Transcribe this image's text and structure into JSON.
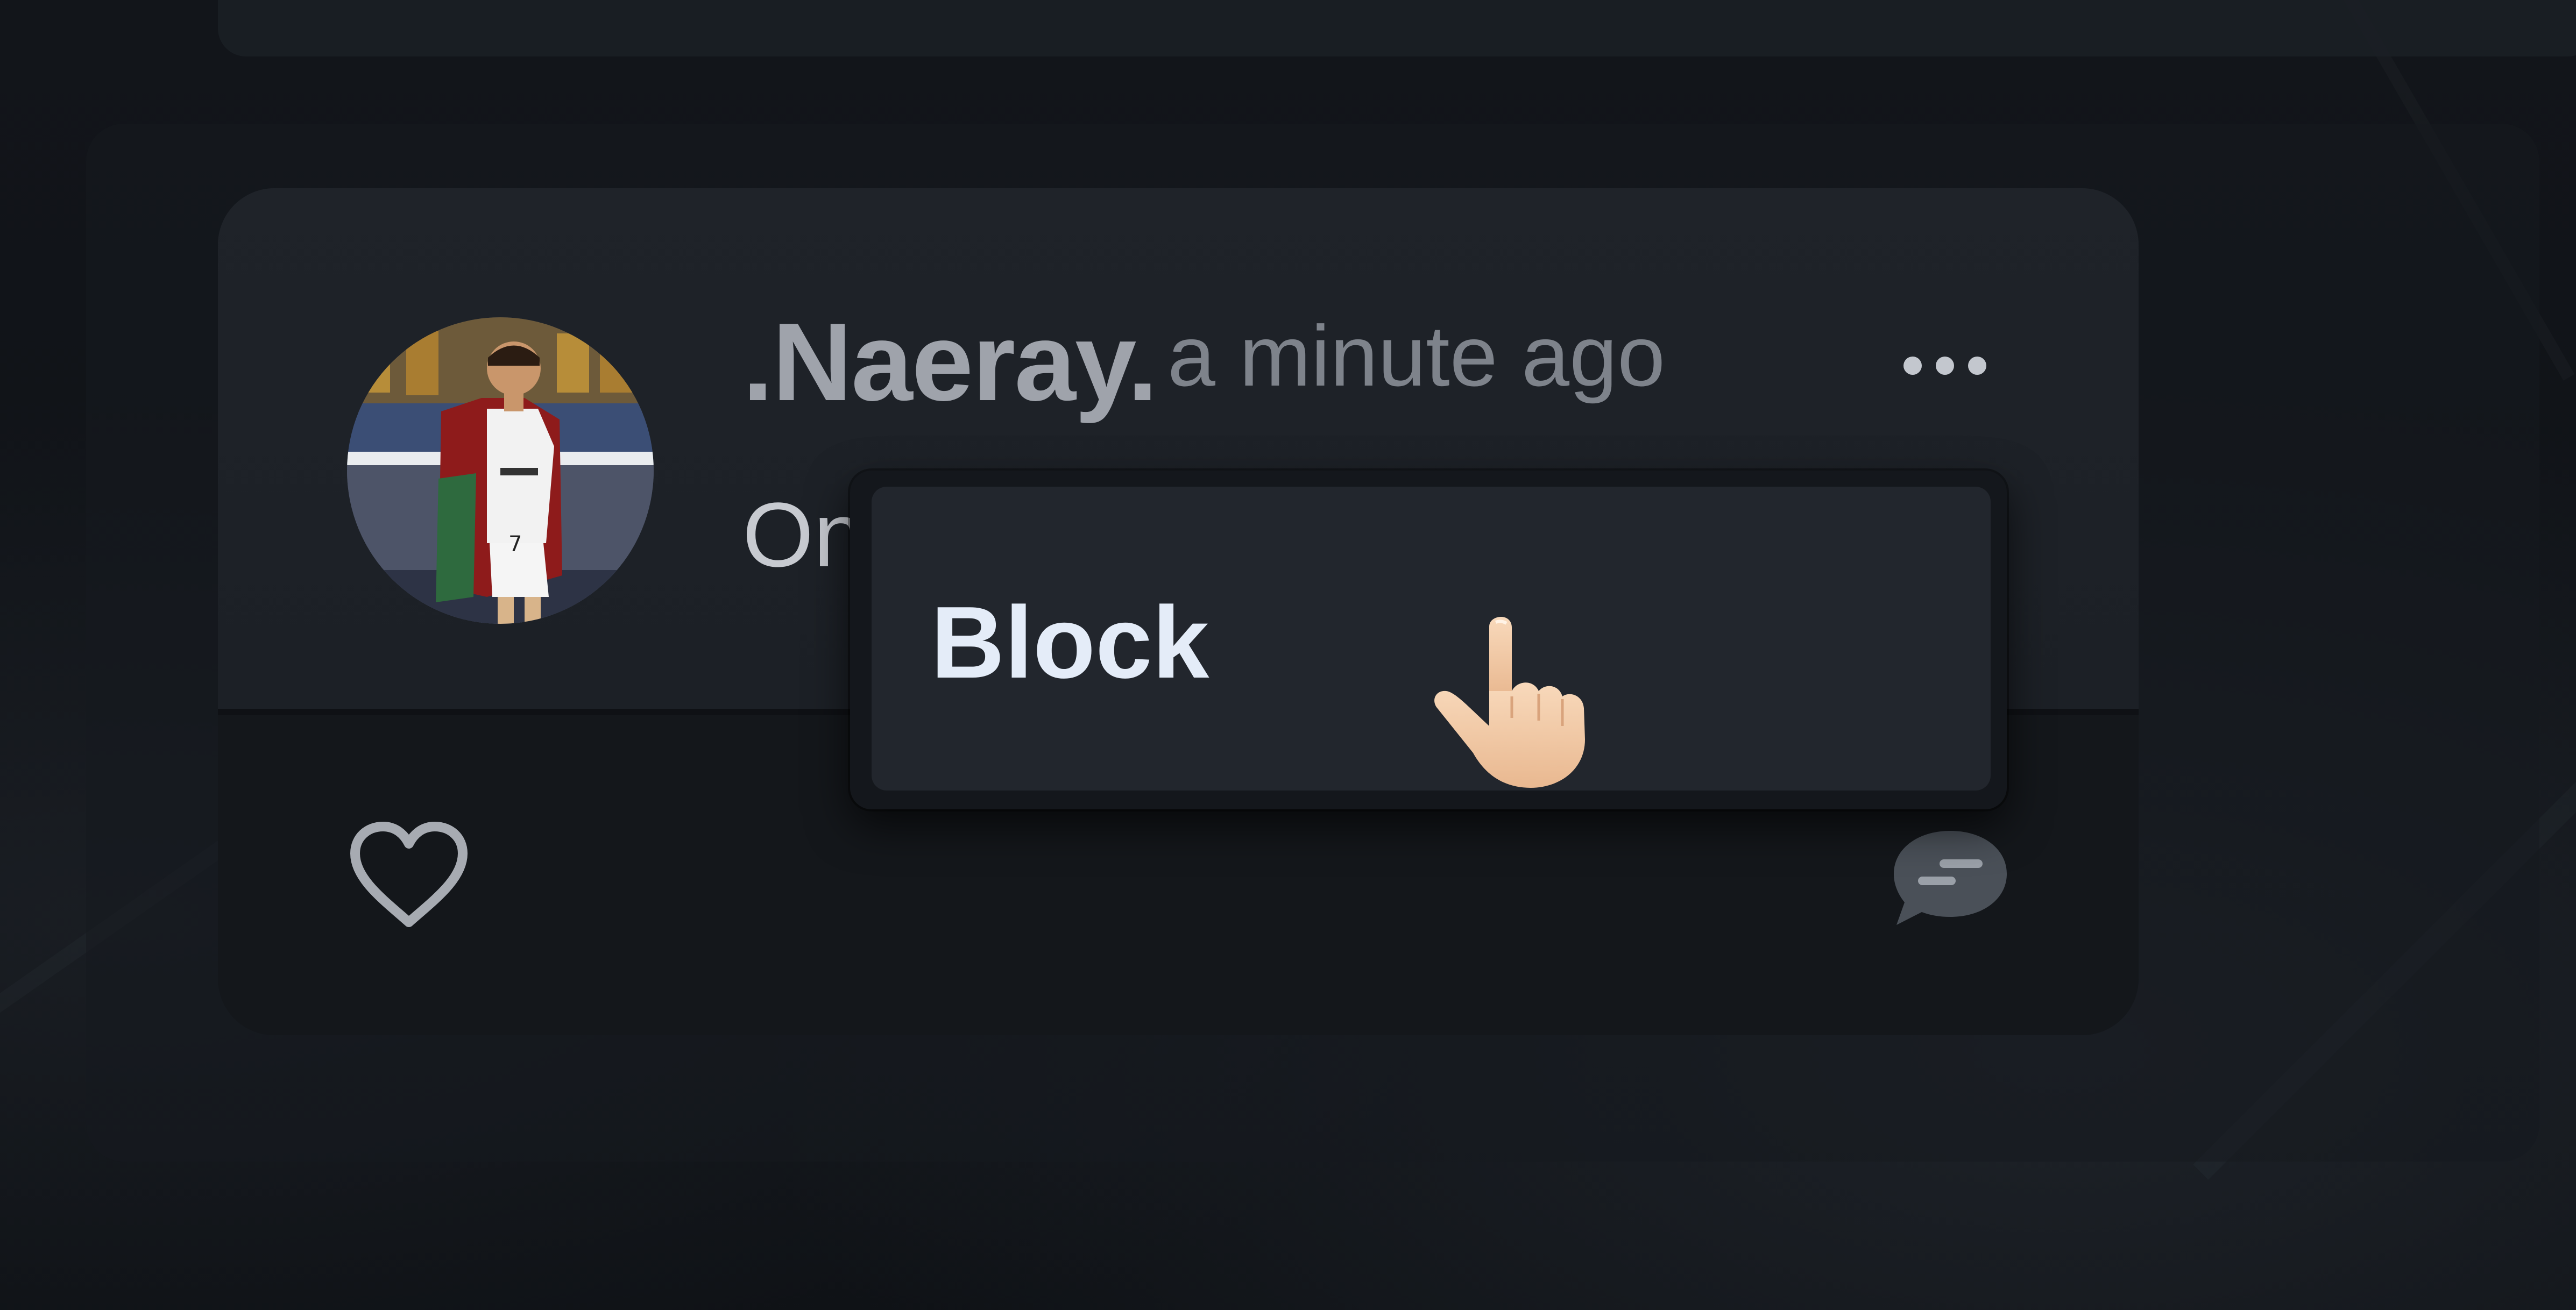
{
  "post": {
    "username": ".Naeray.",
    "timestamp": "a minute ago",
    "text_visible": "On",
    "avatar_icon": "profile-photo"
  },
  "actions": {
    "more_icon": "ellipsis-icon",
    "like_icon": "heart-icon",
    "comment_icon": "chat-bubble-icon"
  },
  "context_menu": {
    "items": [
      {
        "label": "Block"
      }
    ]
  },
  "pointer": {
    "icon": "pointing-hand-cursor"
  },
  "colors": {
    "background": "#0f1216",
    "card": "#1f2329",
    "menu_item": "#22262d",
    "username": "#9fa3ab",
    "menu_text": "#e4ecf8"
  }
}
